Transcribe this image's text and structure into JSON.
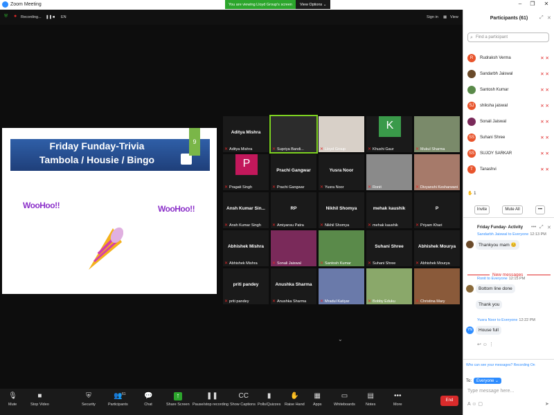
{
  "window": {
    "title": "Zoom Meeting",
    "controls": [
      "–",
      "❐",
      "✕"
    ]
  },
  "share_banner": {
    "text": "You are viewing Lloyd Group's screen",
    "button": "View Options ⌄"
  },
  "topbar": {
    "recording": "Recording...",
    "pause": "❚❚",
    "stop": "■",
    "lang": "EN",
    "sign_in": "Sign in",
    "view": "View"
  },
  "slide": {
    "title1": "Friday Funday-Trivia",
    "title2": "Tambola / Housie / Bingo",
    "page": "9",
    "woo": "WooHoo!!"
  },
  "tiles": [
    {
      "big": "Aditya Mishra",
      "label": "Aditya Mishra",
      "type": "name"
    },
    {
      "big": "",
      "label": "Supriya Bandi...",
      "type": "cam",
      "color": "#2c2c2c"
    },
    {
      "big": "",
      "label": "Lloyd Group",
      "type": "cam",
      "color": "#d8d0c8"
    },
    {
      "big": "",
      "label": "Khushi Gaur",
      "type": "avatar",
      "letter": "K",
      "color": "#3a9a4a"
    },
    {
      "big": "",
      "label": "Mukul Sharma",
      "type": "cam",
      "color": "#7a8a6a"
    },
    {
      "big": "",
      "label": "Pragati Singh",
      "type": "avatar",
      "letter": "P",
      "color": "#c2185b"
    },
    {
      "big": "Prachi Gangwar",
      "label": "Prachi Gangwar",
      "type": "name"
    },
    {
      "big": "Yusra Noor",
      "label": "Yusra Noor",
      "type": "name"
    },
    {
      "big": "",
      "label": "Ronit",
      "type": "cam",
      "color": "#8a8a8a"
    },
    {
      "big": "",
      "label": "Divyanshi Kesharwani",
      "type": "cam",
      "color": "#a67a6a"
    },
    {
      "big": "Ansh Kumar Sin...",
      "label": "Ansh Kumar Singh",
      "type": "name"
    },
    {
      "big": "RP",
      "label": "Amiyansu Patra",
      "type": "name"
    },
    {
      "big": "Nikhil Shomya",
      "label": "Nikhil Shomya",
      "type": "name"
    },
    {
      "big": "mehak kaushik",
      "label": "mehak kaushik",
      "type": "name"
    },
    {
      "big": "P",
      "label": "Priyam Khari",
      "type": "name"
    },
    {
      "big": "Abhishek Mishra",
      "label": "Abhishek Mishra",
      "type": "name"
    },
    {
      "big": "",
      "label": "Sonali Jaiswal",
      "type": "cam",
      "color": "#7a2a5a"
    },
    {
      "big": "",
      "label": "Santosh Kumar",
      "type": "cam",
      "color": "#5a8a4a"
    },
    {
      "big": "Suhani Shree",
      "label": "Suhani Shree",
      "type": "name"
    },
    {
      "big": "Abhishek Mourya",
      "label": "Abhishek Mourya",
      "type": "name"
    },
    {
      "big": "priti pandey",
      "label": "priti pandey",
      "type": "name"
    },
    {
      "big": "Anushka Sharma",
      "label": "Anushka Sharma",
      "type": "name"
    },
    {
      "big": "",
      "label": "Mradul Katiyar",
      "type": "cam",
      "color": "#6a7aaa"
    },
    {
      "big": "",
      "label": "Bobby Eduku",
      "type": "cam",
      "color": "#8aa86a"
    },
    {
      "big": "",
      "label": "Christina Mary",
      "type": "cam",
      "color": "#8a5a3a"
    }
  ],
  "toolbar": [
    {
      "label": "Mute",
      "icon": "🎙"
    },
    {
      "label": "Stop Video",
      "icon": "■"
    },
    {
      "label": "Security",
      "icon": "⛨"
    },
    {
      "label": "Participants",
      "icon": "👥"
    },
    {
      "label": "Chat",
      "icon": "💬"
    },
    {
      "label": "Share Screen",
      "icon": "↑"
    },
    {
      "label": "Pause/stop recording",
      "icon": "❚❚"
    },
    {
      "label": "Show Captions",
      "icon": "CC"
    },
    {
      "label": "Polls/Quizzes",
      "icon": "▮"
    },
    {
      "label": "Raise Hand",
      "icon": "✋"
    },
    {
      "label": "Apps",
      "icon": "▦"
    },
    {
      "label": "Whiteboards",
      "icon": "▭"
    },
    {
      "label": "Notes",
      "icon": "▤"
    },
    {
      "label": "More",
      "icon": "•••"
    }
  ],
  "participants_count": "61",
  "end_label": "End",
  "panel": {
    "title": "Participants (61)",
    "search_placeholder": "Find a participant",
    "participants": [
      {
        "name": "Rudraksh Verma",
        "initial": "R",
        "color": "#e8542c"
      },
      {
        "name": "Sandarbh Jaiswal",
        "initial": "",
        "color": "#6a4a2a"
      },
      {
        "name": "Santosh Kumar",
        "initial": "",
        "color": "#5a8a4a"
      },
      {
        "name": "shiksha jaiswal",
        "initial": "SJ",
        "color": "#e8542c"
      },
      {
        "name": "Sonali Jaiswal",
        "initial": "",
        "color": "#7a2a5a"
      },
      {
        "name": "Suhani Shree",
        "initial": "SS",
        "color": "#e8542c"
      },
      {
        "name": "SUJOY SARKAR",
        "initial": "SS",
        "color": "#e8542c"
      },
      {
        "name": "Tanashvi",
        "initial": "T",
        "color": "#e8542c"
      }
    ],
    "raise_count": "1",
    "invite": "Invite",
    "mute_all": "Mute All",
    "more": "•••",
    "chat_title": "Friday Funday- Activity",
    "messages": [
      {
        "from": "Sandarbh Jaiswal",
        "to": "Everyone",
        "time": "12:13 PM",
        "text": "Thankyou mam 😊"
      },
      {
        "from": "Ronit",
        "to": "Everyone",
        "time": "12:15 PM",
        "text": "Bottom line done"
      },
      {
        "text": "Thank you"
      },
      {
        "from": "Yusra Noor",
        "to": "Everyone",
        "time": "12:22 PM",
        "text": "House full",
        "initials": "YN"
      }
    ],
    "new_messages": "New messages",
    "notice": "Who can see your messages? Recording On",
    "to_label": "To:",
    "to_value": "Everyone ⌄",
    "input_placeholder": "Type message here..."
  },
  "colors": {
    "accent": "#2D8CFF",
    "green": "#2ca52c",
    "end": "#d92b2b"
  }
}
